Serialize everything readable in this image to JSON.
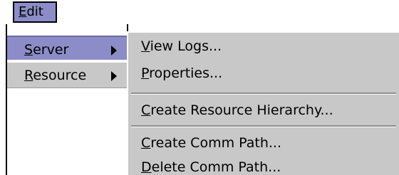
{
  "menubar": {
    "edit_label": "Edit"
  },
  "main_menu": {
    "items": [
      {
        "label": "Server",
        "mnemonic": "S",
        "highlighted": true
      },
      {
        "label": "Resource",
        "mnemonic": "R",
        "highlighted": false
      }
    ]
  },
  "submenu": {
    "items": [
      {
        "label": "View Logs...",
        "mnemonic": "V"
      },
      {
        "label": "Properties...",
        "mnemonic": "P"
      },
      {
        "label": "Create Resource Hierarchy...",
        "mnemonic": "C"
      },
      {
        "label": "Create Comm Path...",
        "mnemonic": "C"
      },
      {
        "label": "Delete Comm Path...",
        "mnemonic": "D"
      }
    ]
  },
  "colors": {
    "highlight": "#8c8cc8",
    "menu_background": "#c8c8c8",
    "separator": "#8e8e8e"
  }
}
